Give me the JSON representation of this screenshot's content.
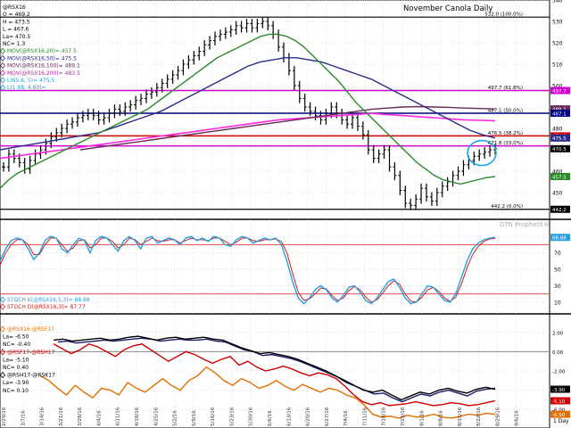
{
  "chart_data": [
    {
      "type": "candlestick",
      "title": "November Canola Daily",
      "ylim": [
        440,
        540
      ],
      "y_ticks": [
        450,
        460,
        470,
        480,
        490,
        500,
        510,
        520,
        530,
        540
      ],
      "x_dates": [
        "2/29/16",
        "3/7/16",
        "3/14/16",
        "3/21/16",
        "3/28/16",
        "4/4/16",
        "4/11/16",
        "4/18/16",
        "4/25/16",
        "5/2/16",
        "5/9/16",
        "5/16/16",
        "5/23/16",
        "5/30/16",
        "6/6/16",
        "6/13/16",
        "6/20/16",
        "6/27/16",
        "7/4/16",
        "7/11/16",
        "7/18/16",
        "7/25/16",
        "8/1/16",
        "8/8/16",
        "8/15/16",
        "8/22/16",
        "8/29/16",
        "9/6/16"
      ],
      "x_axis_label": "1 Day",
      "legend": [
        {
          "text": "@RSX16",
          "color": "#000000"
        },
        {
          "text": "O = 469.2",
          "color": "#000000"
        },
        {
          "text": "H = 473.5",
          "color": "#000000"
        },
        {
          "text": "L = 467.6",
          "color": "#000000"
        },
        {
          "text": "La= 470.5",
          "color": "#000000"
        },
        {
          "text": "NC= 1.3",
          "color": "#000000"
        },
        {
          "text": "MOV(@RSX16,20)= 457.5",
          "color": "#2a8a2a"
        },
        {
          "text": "MOV(@RSX16,50)= 475.5",
          "color": "#2b2b8c"
        },
        {
          "text": "MOV(@RSX16,100)= 489.1",
          "color": "#6a2a5a"
        },
        {
          "text": "MOV(@RSX16,200)= 483.5",
          "color": "#b02aa0"
        },
        {
          "text": "L(65.6, 5)= 475.5",
          "color": "#2aa0d0"
        },
        {
          "text": "L(1.88, 4.60)= ",
          "color": "#2aa0d0"
        }
      ],
      "h_lines": [
        {
          "value": 532.0,
          "label": "532.0 (100.0%)",
          "color": "#000000"
        },
        {
          "value": 497.7,
          "label": "497.7 (61.8%)",
          "color": "#d000d0"
        },
        {
          "value": 487.1,
          "label": "487.1 (50.0%)",
          "color": "#000080"
        },
        {
          "value": 476.5,
          "label": "476.5 (38.2%)",
          "color": "#d00000"
        },
        {
          "value": 471.8,
          "label": "471.8 (33.0%)",
          "color": "#d000d0"
        },
        {
          "value": 442.2,
          "label": "442.2 (0.0%)",
          "color": "#000000"
        }
      ],
      "right_tags": [
        {
          "value": 497.7,
          "label": "497.7",
          "color": "#d000d0"
        },
        {
          "value": 489.1,
          "label": "489.1",
          "color": "#6a2a5a"
        },
        {
          "value": 487.1,
          "label": "487.1",
          "color": "#000080"
        },
        {
          "value": 476.5,
          "label": "476.5",
          "color": "#d00000"
        },
        {
          "value": 475.5,
          "label": "475.5",
          "color": "#2b2b8c"
        },
        {
          "value": 470.5,
          "label": "470.5",
          "color": "#000000"
        },
        {
          "value": 457.5,
          "label": "457.5",
          "color": "#2a8a2a"
        },
        {
          "value": 442.2,
          "label": "442.2",
          "color": "#000000"
        }
      ],
      "ohlc_close": [
        462,
        468,
        466,
        464,
        461,
        465,
        468,
        470,
        473,
        476,
        478,
        480,
        482,
        483,
        485,
        486,
        487,
        486,
        484,
        485,
        487,
        489,
        488,
        490,
        491,
        493,
        494,
        496,
        497,
        499,
        501,
        503,
        505,
        507,
        510,
        512,
        514,
        516,
        519,
        521,
        523,
        524,
        525,
        526,
        528,
        527,
        529,
        527,
        529,
        530,
        528,
        524,
        518,
        513,
        507,
        500,
        494,
        490,
        488,
        486,
        484,
        487,
        490,
        487,
        484,
        482,
        485,
        481,
        477,
        470,
        466,
        468,
        470,
        462,
        458,
        451,
        445,
        444,
        447,
        452,
        448,
        446,
        450,
        453,
        455,
        458,
        460,
        463,
        465,
        467,
        468,
        469,
        470,
        470.5
      ],
      "ma20": [
        452,
        456,
        459,
        461,
        463,
        465,
        467,
        469,
        471,
        473,
        475,
        477,
        479,
        481,
        483,
        485,
        487,
        489,
        492,
        495,
        498,
        501,
        504,
        507,
        510,
        513,
        515,
        517,
        519,
        521,
        523,
        524,
        524,
        523,
        521,
        518,
        514,
        510,
        506,
        502,
        497,
        492,
        488,
        484,
        480,
        476,
        472,
        468,
        464,
        461,
        458,
        456,
        455,
        454,
        455,
        456,
        457,
        457.5
      ],
      "ma50": [
        470,
        471,
        472,
        473,
        474,
        475,
        476,
        477,
        478,
        480,
        482,
        484,
        486,
        488,
        491,
        494,
        497,
        500,
        503,
        506,
        509,
        511,
        512,
        513,
        513,
        512,
        511,
        509,
        507,
        505,
        503,
        500,
        497,
        494,
        491,
        488,
        485,
        482,
        479,
        477,
        475.5
      ],
      "ma100": [
        470,
        471,
        472,
        473,
        474,
        475,
        476,
        477,
        478,
        479,
        480,
        481,
        482,
        483,
        484,
        485,
        486,
        487,
        488,
        489,
        489.5,
        490,
        490.2,
        490,
        489.8,
        489.5,
        489.3,
        489.1
      ],
      "ma200": [
        466,
        467,
        468,
        469,
        470,
        471,
        472,
        473,
        474,
        475,
        476,
        477,
        478,
        479,
        480,
        481,
        482,
        483,
        484,
        484.5,
        485,
        485.5,
        486,
        486.5,
        487,
        486.5,
        486,
        485.5,
        485,
        484.5,
        484,
        483.8,
        483.5
      ],
      "annotation": "ellipse around latest price action"
    },
    {
      "type": "line",
      "name": "stochastic",
      "watermark": "DTN ProphetX®",
      "ylim": [
        0,
        100
      ],
      "y_ticks": [
        10,
        30,
        50,
        70,
        90
      ],
      "ref_lines": [
        80,
        20
      ],
      "legend": [
        {
          "text": "STOCH K(@RSX16,5,3)= 88.88",
          "color": "#2aa0e0"
        },
        {
          "text": "STOCH D(@RSX16,3)= 87.77",
          "color": "#d02020"
        }
      ],
      "right_tags": [
        {
          "value": 88.88,
          "label": "88.88",
          "color": "#2aa0e0"
        }
      ],
      "series": [
        {
          "name": "STOCH K",
          "color": "#2aa0e0",
          "values": [
            60,
            75,
            85,
            88,
            86,
            75,
            62,
            70,
            85,
            90,
            88,
            75,
            70,
            80,
            88,
            85,
            70,
            85,
            90,
            88,
            80,
            72,
            85,
            90,
            85,
            75,
            88,
            90,
            82,
            85,
            88,
            86,
            80,
            88,
            90,
            85,
            88,
            84,
            90,
            88,
            80,
            78,
            86,
            90,
            88,
            82,
            85,
            88,
            86,
            88,
            80,
            60,
            35,
            15,
            8,
            15,
            25,
            30,
            25,
            15,
            10,
            18,
            28,
            30,
            22,
            12,
            8,
            15,
            25,
            35,
            38,
            28,
            15,
            8,
            10,
            20,
            30,
            28,
            20,
            12,
            10,
            20,
            40,
            60,
            75,
            82,
            86,
            88,
            88.88
          ]
        },
        {
          "name": "STOCH D",
          "color": "#d02020",
          "values": [
            55,
            70,
            80,
            86,
            86,
            80,
            68,
            68,
            80,
            88,
            88,
            80,
            72,
            76,
            85,
            86,
            76,
            80,
            88,
            88,
            84,
            76,
            80,
            88,
            86,
            80,
            84,
            88,
            85,
            84,
            86,
            86,
            82,
            85,
            88,
            86,
            86,
            85,
            88,
            88,
            84,
            80,
            83,
            88,
            88,
            85,
            84,
            86,
            86,
            87,
            84,
            70,
            45,
            22,
            12,
            14,
            20,
            27,
            26,
            18,
            12,
            15,
            24,
            29,
            25,
            16,
            10,
            13,
            21,
            30,
            36,
            32,
            20,
            11,
            10,
            16,
            25,
            28,
            23,
            15,
            11,
            16,
            32,
            52,
            68,
            78,
            84,
            87,
            87.77
          ]
        }
      ]
    },
    {
      "type": "line",
      "name": "spreads",
      "ylim": [
        -7,
        3
      ],
      "y_ticks": [
        -6,
        -4,
        -2,
        0,
        2
      ],
      "legend": [
        {
          "text": "@RSX16-@RSF17",
          "color": "#e07000"
        },
        {
          "text": "La= -6.50",
          "color": "#000000"
        },
        {
          "text": "NC= -0.40",
          "color": "#000000"
        },
        {
          "text": "@RSF17-@RSH17",
          "color": "#d00000"
        },
        {
          "text": "La= -5.10",
          "color": "#000000"
        },
        {
          "text": "NC= 0.40",
          "color": "#000000"
        },
        {
          "text": "@RSH17-@RSK17",
          "color": "#000000"
        },
        {
          "text": "La= -3.90",
          "color": "#000000"
        },
        {
          "text": "NC= 0.10",
          "color": "#000000"
        }
      ],
      "right_tags": [
        {
          "value": -3.9,
          "label": "-3.90",
          "color": "#000000"
        },
        {
          "value": -5.1,
          "label": "-5.10",
          "color": "#d00000"
        },
        {
          "value": -6.5,
          "label": "-6.50",
          "color": "#e07000"
        }
      ],
      "series": [
        {
          "name": "@RSX16-@RSF17",
          "color": "#e07000",
          "values": [
            -2.5,
            -3.0,
            -3.8,
            -4.5,
            -3.5,
            -4.2,
            -4.8,
            -3.8,
            -4.0,
            -4.5,
            -3.2,
            -3.8,
            -4.2,
            -3.5,
            -2.8,
            -3.5,
            -4.0,
            -3.0,
            -2.5,
            -1.6,
            -2.2,
            -3.0,
            -3.5,
            -2.8,
            -3.2,
            -3.8,
            -3.5,
            -3.0,
            -3.6,
            -4.0,
            -3.4,
            -3.8,
            -4.2,
            -3.8,
            -4.0,
            -4.5,
            -4.8,
            -5.5,
            -6.5,
            -6.8,
            -6.7,
            -6.9,
            -6.6,
            -6.8,
            -6.7,
            -6.5,
            -6.8,
            -6.9,
            -6.7,
            -6.5,
            -6.6,
            -6.4,
            -6.5
          ]
        },
        {
          "name": "@RSF17-@RSH17",
          "color": "#d00000",
          "values": [
            0.8,
            0.3,
            -0.2,
            0.2,
            0.8,
            0.5,
            0.0,
            -0.5,
            0.2,
            0.6,
            0.8,
            0.2,
            -0.4,
            -1.0,
            -0.5,
            0.0,
            -0.3,
            -0.8,
            -1.2,
            -0.8,
            -0.5,
            -1.4,
            -1.0,
            -1.6,
            -2.0,
            -1.8,
            -1.5,
            -1.8,
            -2.2,
            -2.5,
            -2.2,
            -2.4,
            -2.8,
            -3.6,
            -4.5,
            -5.2,
            -5.5,
            -5.3,
            -5.6,
            -5.5,
            -5.4,
            -5.2,
            -5.4,
            -5.6,
            -5.5,
            -5.3,
            -5.4,
            -5.6,
            -5.5,
            -5.3,
            -5.1
          ]
        },
        {
          "name": "@RSH17-@RSK17",
          "color": "#000000",
          "values": [
            1.2,
            1.3,
            1.1,
            1.2,
            1.3,
            1.4,
            1.2,
            1.3,
            1.5,
            1.6,
            1.4,
            1.2,
            1.4,
            1.5,
            1.3,
            1.4,
            1.5,
            1.3,
            1.2,
            0.8,
            0.4,
            0.1,
            -0.2,
            -0.1,
            -0.3,
            -0.5,
            -0.8,
            -1.2,
            -1.6,
            -2.0,
            -2.5,
            -3.0,
            -3.5,
            -4.0,
            -4.2,
            -4.0,
            -4.5,
            -5.0,
            -4.6,
            -4.2,
            -4.4,
            -4.0,
            -3.8,
            -4.1,
            -4.3,
            -3.9,
            -3.7,
            -3.9
          ]
        },
        {
          "name": "",
          "color": "#1a1a6a",
          "values": [
            1.0,
            1.1,
            0.9,
            1.0,
            1.1,
            1.2,
            1.1,
            1.2,
            1.3,
            1.4,
            1.3,
            1.1,
            1.2,
            1.3,
            1.2,
            1.2,
            1.3,
            1.1,
            1.0,
            0.6,
            0.2,
            0.0,
            -0.4,
            -0.3,
            -0.5,
            -0.7,
            -1.0,
            -1.4,
            -1.8,
            -2.2,
            -2.6,
            -3.2,
            -3.6,
            -4.0,
            -4.4,
            -4.3,
            -4.8,
            -5.2,
            -4.8,
            -4.4,
            -4.6,
            -4.2,
            -4.0,
            -4.3,
            -4.6,
            -4.1,
            -3.9,
            -3.8
          ]
        }
      ]
    }
  ]
}
